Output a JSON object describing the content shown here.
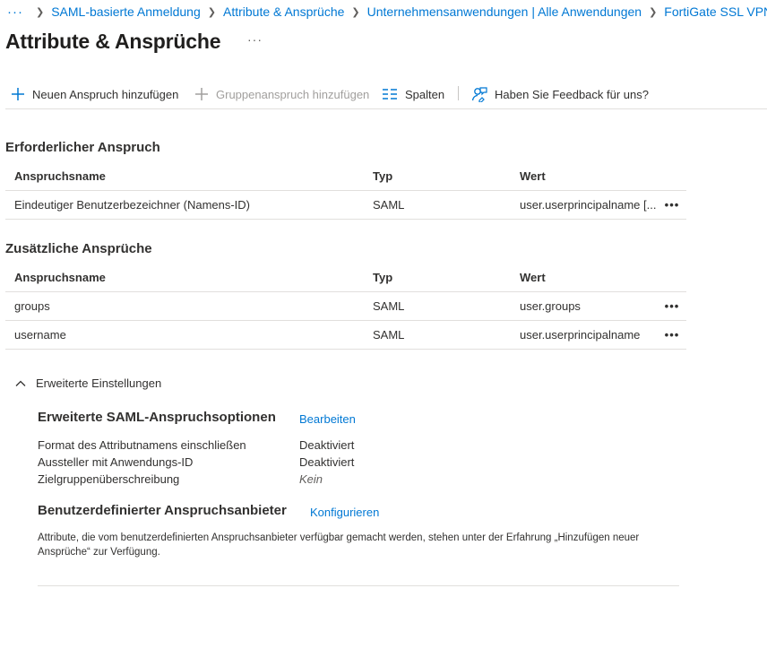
{
  "breadcrumb": {
    "more": "···",
    "items": [
      "SAML-basierte Anmeldung",
      "Attribute & Ansprüche",
      "Unternehmensanwendungen | Alle Anwendungen",
      "FortiGate SSL VPN |"
    ]
  },
  "page": {
    "title": "Attribute & Ansprüche",
    "more": "···"
  },
  "toolbar": {
    "add_claim": "Neuen Anspruch hinzufügen",
    "add_group_claim": "Gruppenanspruch hinzufügen",
    "columns": "Spalten",
    "feedback": "Haben Sie Feedback für uns?"
  },
  "required": {
    "title": "Erforderlicher Anspruch",
    "headers": {
      "name": "Anspruchsname",
      "typ": "Typ",
      "wert": "Wert"
    },
    "rows": [
      {
        "name": "Eindeutiger Benutzerbezeichner (Namens-ID)",
        "typ": "SAML",
        "wert": "user.userprincipalname [...",
        "more": "•••"
      }
    ]
  },
  "additional": {
    "title": "Zusätzliche Ansprüche",
    "headers": {
      "name": "Anspruchsname",
      "typ": "Typ",
      "wert": "Wert"
    },
    "rows": [
      {
        "name": "groups",
        "typ": "SAML",
        "wert": "user.groups",
        "more": "•••"
      },
      {
        "name": "username",
        "typ": "SAML",
        "wert": "user.userprincipalname",
        "more": "•••"
      }
    ]
  },
  "advanced": {
    "toggle_label": "Erweiterte Einstellungen",
    "saml_options": {
      "title": "Erweiterte SAML-Anspruchsoptionen",
      "edit_link": "Bearbeiten",
      "items": [
        {
          "label": "Format des Attributnamens einschließen",
          "value": "Deaktiviert"
        },
        {
          "label": "Aussteller mit Anwendungs-ID",
          "value": "Deaktiviert"
        },
        {
          "label": "Zielgruppenüberschreibung",
          "value": "Kein"
        }
      ]
    },
    "custom_provider": {
      "title": "Benutzerdefinierter Anspruchsanbieter",
      "configure_link": "Konfigurieren",
      "description": "Attribute, die vom benutzerdefinierten Anspruchsanbieter verfügbar gemacht werden, stehen unter der Erfahrung „Hinzufügen neuer Ansprüche“ zur Verfügung."
    }
  },
  "colors": {
    "accent": "#0078d4",
    "text": "#323130",
    "muted": "#a19f9d",
    "border": "#e1dfdd"
  }
}
